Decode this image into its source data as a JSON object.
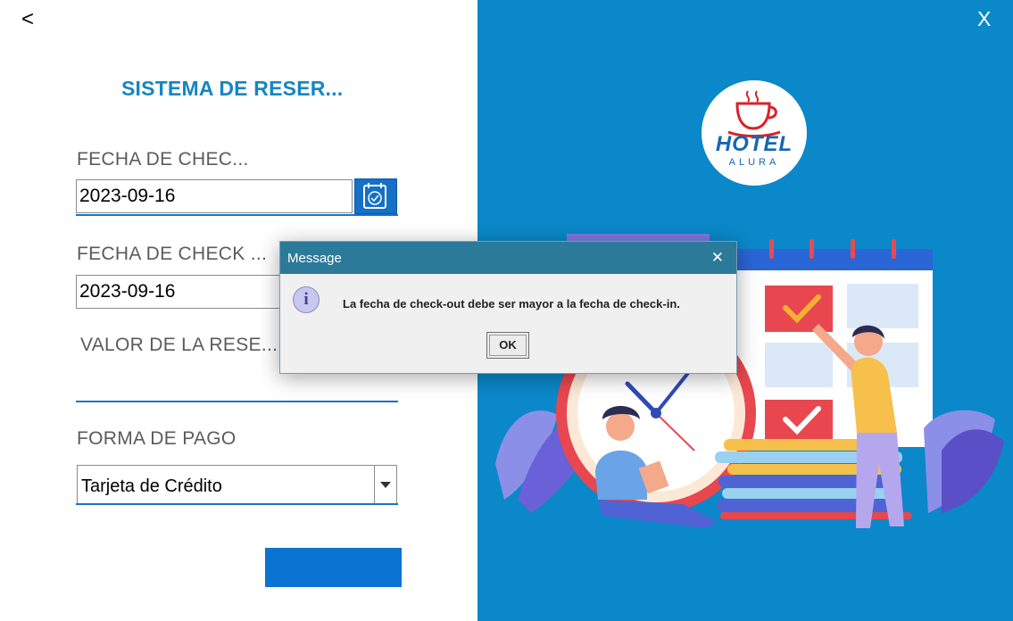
{
  "window": {
    "back_label": "<",
    "close_label": "X"
  },
  "form": {
    "title": "SISTEMA DE RESER...",
    "checkin_label": "FECHA DE CHEC...",
    "checkin_value": "2023-09-16",
    "checkout_label": "FECHA DE CHECK ...",
    "checkout_value": "2023-09-16",
    "valor_label": "VALOR DE LA RESE...",
    "valor_value": "",
    "pago_label": "FORMA DE PAGO",
    "pago_value": "Tarjeta de Crédito"
  },
  "logo": {
    "line1": "HOTEL",
    "line2": "ALURA"
  },
  "dialog": {
    "title": "Message",
    "close_label": "✕",
    "message": "La fecha de check-out debe ser mayor a la fecha de check-in.",
    "ok_label": "OK"
  },
  "colors": {
    "accent": "#0b88c9",
    "button": "#0b74d3",
    "title": "#1586c3"
  }
}
